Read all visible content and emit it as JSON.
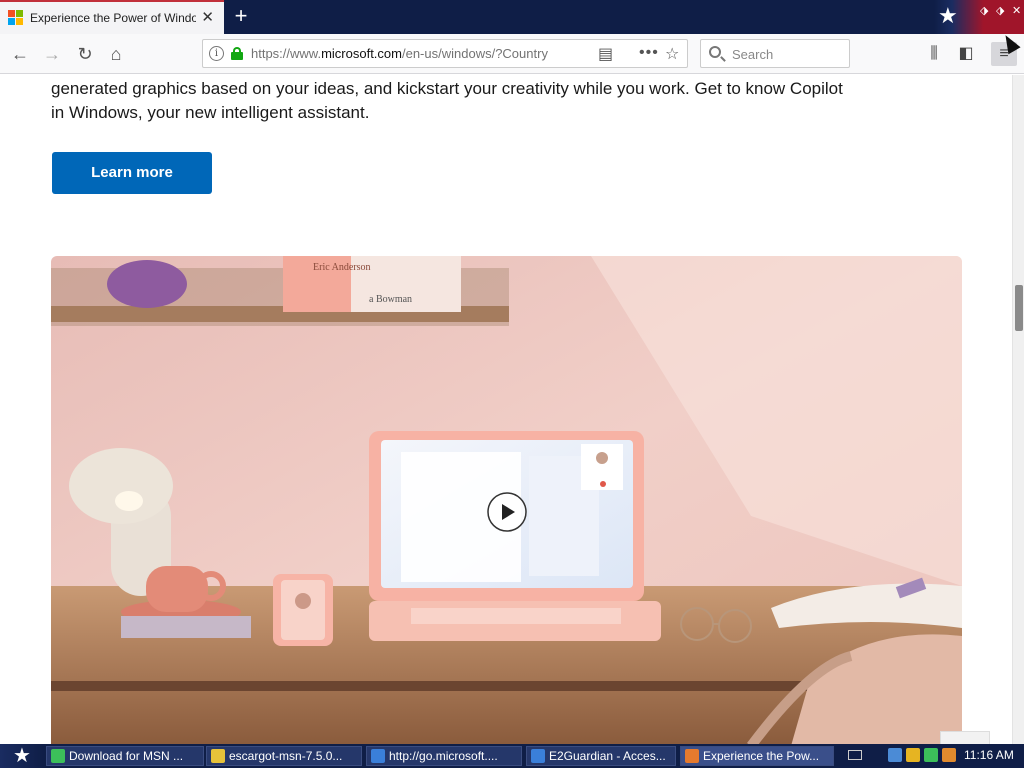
{
  "browser": {
    "tab_title": "Experience the Power of Windows",
    "new_tab_label": "+",
    "url_prefix": "https://www.",
    "url_host": "microsoft.com",
    "url_path": "/en-us/windows/?Country",
    "search_placeholder": "Search"
  },
  "page": {
    "paragraph": "generated graphics based on your ideas, and kickstart your creativity while you work. Get to know Copilot in Windows, your new intelligent assistant.",
    "learn_more": "Learn more",
    "book_text_1": "Eric Anderson",
    "book_text_2": "a Bowman"
  },
  "taskbar": {
    "items": [
      {
        "label": "Download for MSN ..."
      },
      {
        "label": "escargot-msn-7.5.0..."
      },
      {
        "label": "http://go.microsoft...."
      },
      {
        "label": "E2Guardian - Acces..."
      },
      {
        "label": "Experience the Pow..."
      }
    ],
    "clock": "11:16 AM"
  },
  "colors": {
    "accent": "#0067b8",
    "tab_strip": "#0f1e47",
    "lock_green": "#12a712"
  }
}
